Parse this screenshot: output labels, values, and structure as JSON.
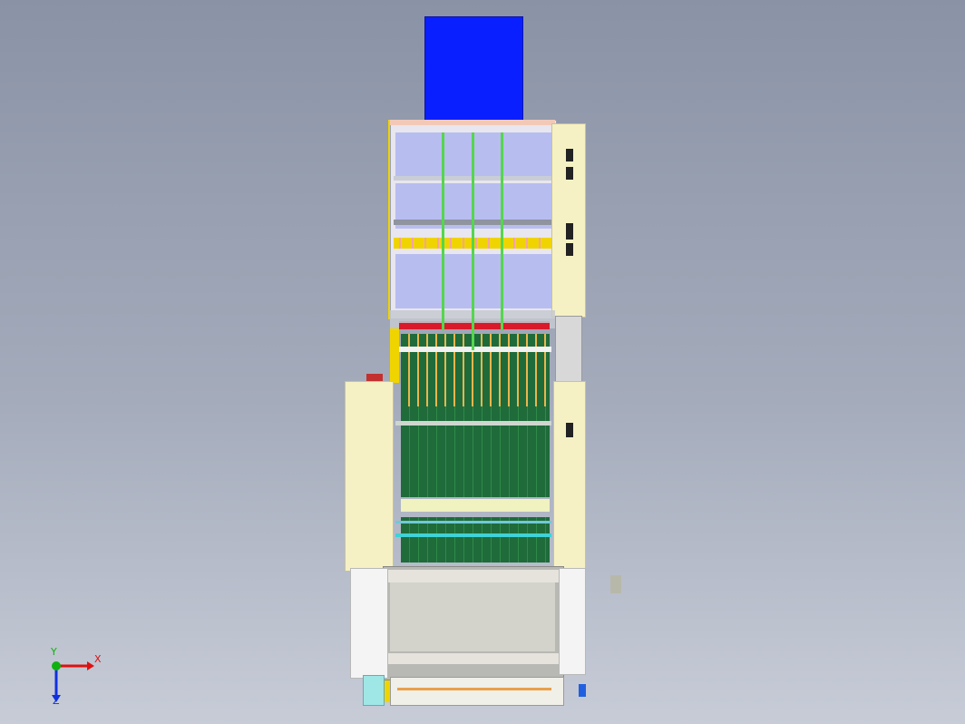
{
  "viewport": {
    "axis_triad": {
      "x_label": "X",
      "y_label": "Y",
      "z_label": "Z",
      "x_color": "#e01010",
      "y_color": "#10b010",
      "z_color": "#1030e0"
    }
  },
  "colors": {
    "background_top": "#8a93a6",
    "background_bottom": "#c7ccd7",
    "motor_blue": "#0a1fff",
    "panel_cream": "#f6f1c4",
    "chamber_lavender": "#b8bdf0",
    "belt_green": "#1f6b3a",
    "frame_yellow": "#f0d400",
    "rail_green": "#55d64d",
    "tray_gray": "#d3d3cb"
  }
}
